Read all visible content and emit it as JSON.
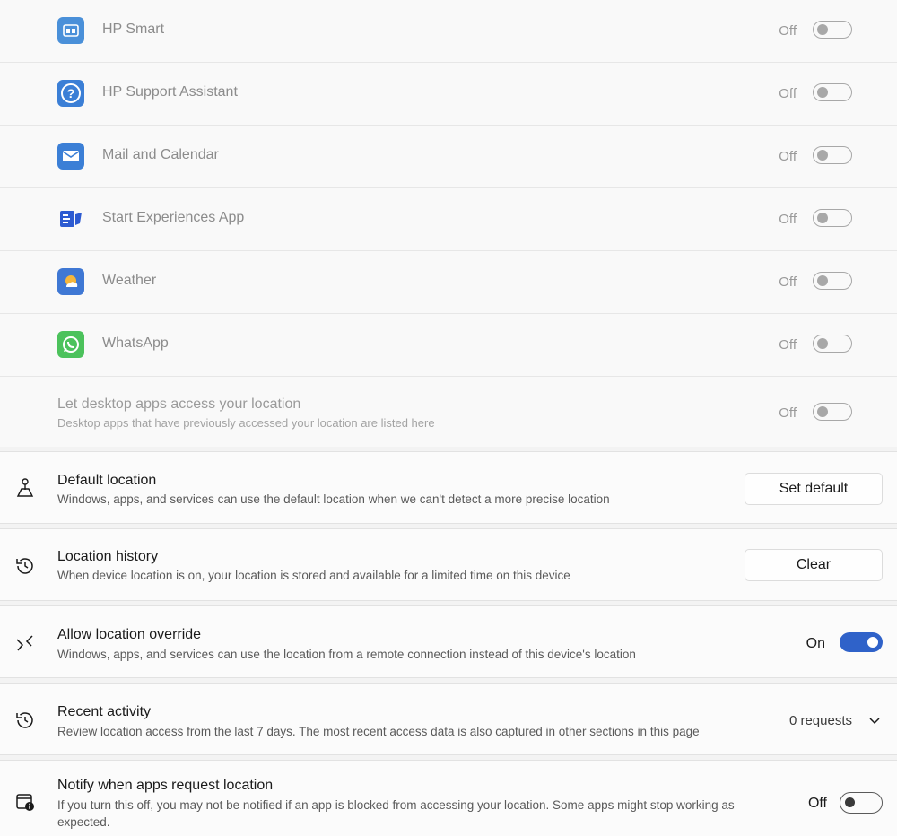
{
  "apps": [
    {
      "name": "HP Smart",
      "state": "Off",
      "icon": "hp-smart-icon",
      "color": "#4a90d9"
    },
    {
      "name": "HP Support Assistant",
      "state": "Off",
      "icon": "hp-support-icon",
      "color": "#3b7fd6"
    },
    {
      "name": "Mail and Calendar",
      "state": "Off",
      "icon": "mail-calendar-icon",
      "color": "#3b7fd6"
    },
    {
      "name": "Start Experiences App",
      "state": "Off",
      "icon": "start-experiences-icon",
      "color": "#2d5bd1"
    },
    {
      "name": "Weather",
      "state": "Off",
      "icon": "weather-icon",
      "color": "#3f78d4"
    },
    {
      "name": "WhatsApp",
      "state": "Off",
      "icon": "whatsapp-icon",
      "color": "#4cc25c"
    }
  ],
  "desktop_apps": {
    "title": "Let desktop apps access your location",
    "subtitle": "Desktop apps that have previously accessed your location are listed here",
    "state": "Off"
  },
  "default_location": {
    "title": "Default location",
    "subtitle": "Windows, apps, and services can use the default location when we can't detect a more precise location",
    "button": "Set default"
  },
  "location_history": {
    "title": "Location history",
    "subtitle": "When device location is on, your location is stored and available for a limited time on this device",
    "button": "Clear"
  },
  "location_override": {
    "title": "Allow location override",
    "subtitle": "Windows, apps, and services can use the location from a remote connection instead of this device's location",
    "state": "On"
  },
  "recent_activity": {
    "title": "Recent activity",
    "subtitle": "Review location access from the last 7 days. The most recent access data is also captured in other sections in this page",
    "value": "0 requests"
  },
  "notify": {
    "title": "Notify when apps request location",
    "subtitle": "If you turn this off, you may not be notified if an app is blocked from accessing your location. Some apps might stop working as expected.",
    "state": "Off"
  },
  "colors": {
    "accent": "#2f62c9"
  }
}
